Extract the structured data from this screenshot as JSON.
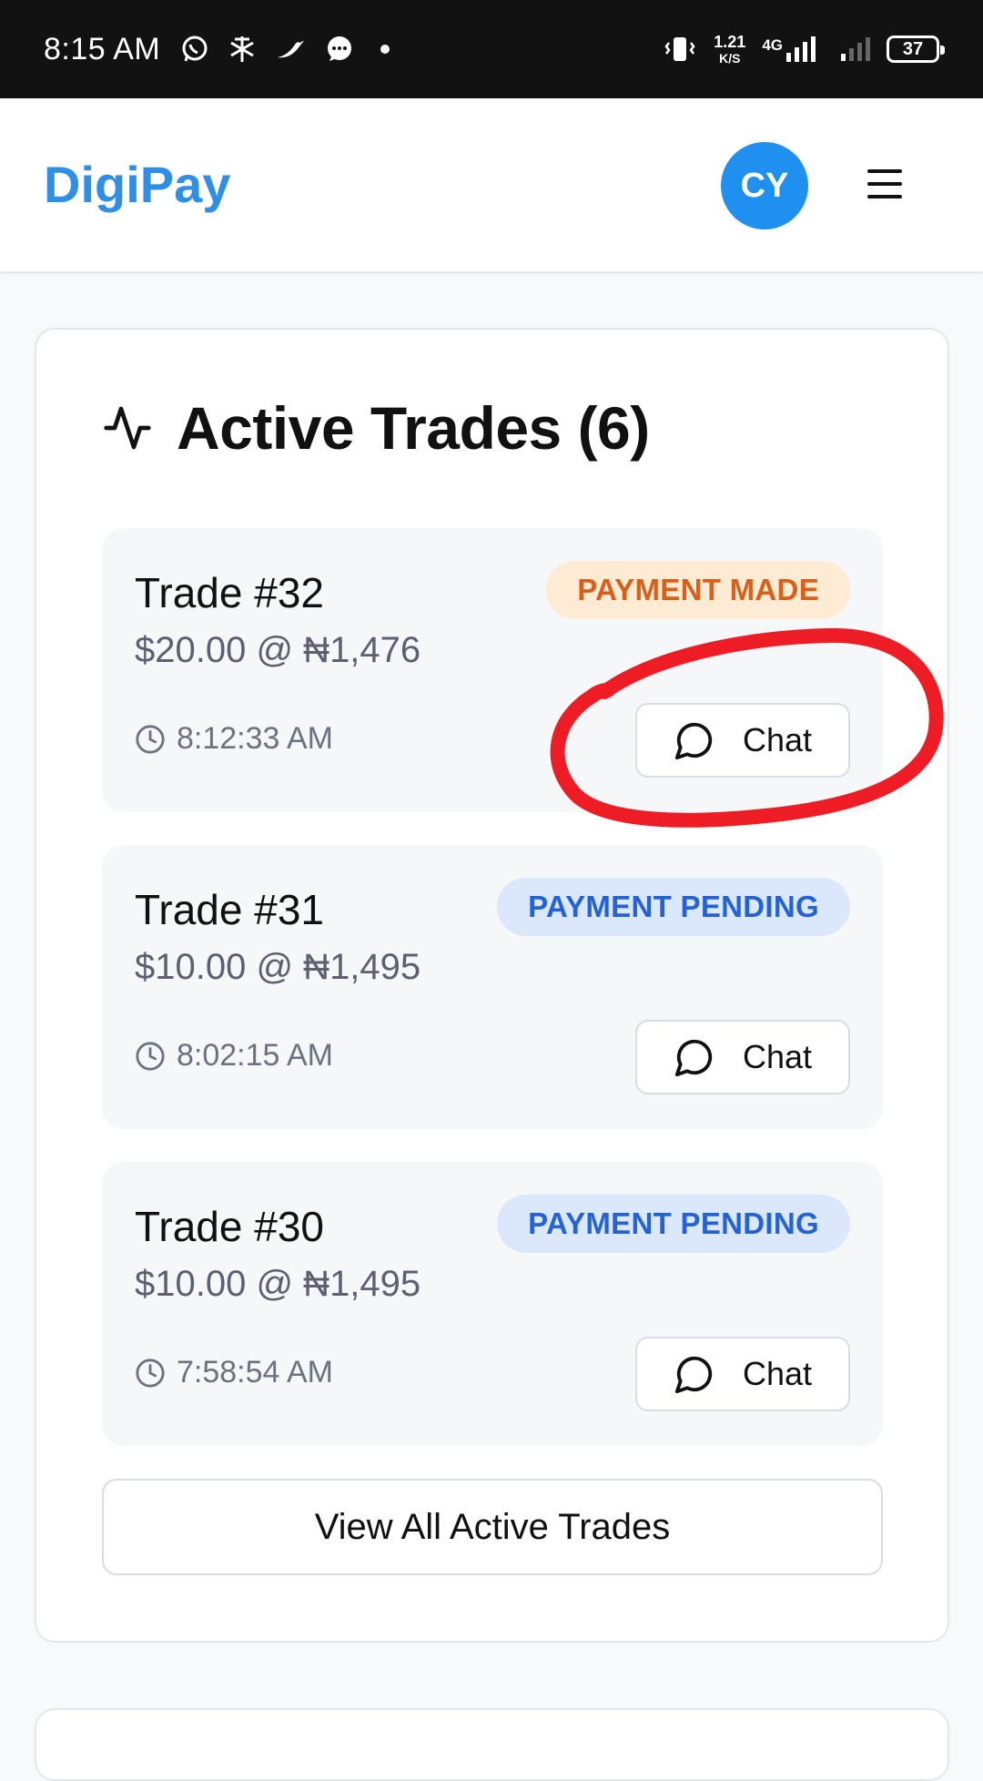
{
  "status_bar": {
    "time": "8:15 AM",
    "speed_value": "1.21",
    "speed_unit": "K/S",
    "network": "4G",
    "battery": "37",
    "left_icons": [
      "whatsapp-icon",
      "app-notification-icon",
      "pepper-icon",
      "messages-icon",
      "more-notifications-dot"
    ],
    "right_icons": [
      "vibrate-icon",
      "signal-strength-icon",
      "signal-strength-weak-icon",
      "battery-icon"
    ]
  },
  "header": {
    "brand": "DigiPay",
    "avatar_initials": "CY",
    "menu_icon": "hamburger-menu-icon"
  },
  "active_trades": {
    "title": "Active Trades (6)",
    "title_icon": "activity-pulse-icon",
    "trades": [
      {
        "id_label": "Trade #32",
        "amount": "$20.00 @ ₦1,476",
        "time": "8:12:33 AM",
        "status": "PAYMENT MADE",
        "chat_label": "Chat"
      },
      {
        "id_label": "Trade #31",
        "amount": "$10.00 @ ₦1,495",
        "time": "8:02:15 AM",
        "status": "PAYMENT PENDING",
        "chat_label": "Chat"
      },
      {
        "id_label": "Trade #30",
        "amount": "$10.00 @ ₦1,495",
        "time": "7:58:54 AM",
        "status": "PAYMENT PENDING",
        "chat_label": "Chat"
      }
    ],
    "view_all_label": "View All Active Trades"
  },
  "colors": {
    "brand": "#2f8fe6",
    "avatar_bg": "#1f8ff0",
    "status_made_bg": "#fdebd3",
    "status_made_text": "#d9601a",
    "status_pending_bg": "#dbe8fb",
    "status_pending_text": "#2563d4",
    "annotation_red": "#ee1c24"
  },
  "annotation": {
    "type": "hand-drawn red circle",
    "target": "Chat button of Trade #32"
  }
}
